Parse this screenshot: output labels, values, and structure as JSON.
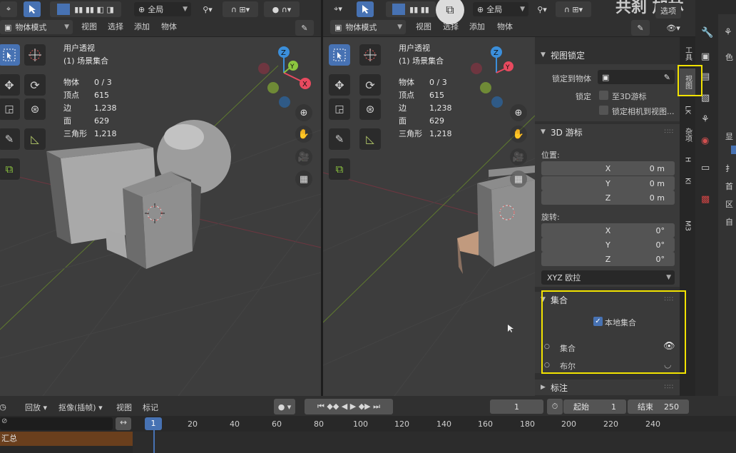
{
  "colors": {
    "accent": "#4772b3",
    "highlight": "#f2e300",
    "x_axis": "#e84a5f",
    "y_axis": "#8cc63f",
    "z_axis": "#3b8fdb"
  },
  "left_viewport": {
    "header": {
      "pivot_label": "全局",
      "mode": "物体模式",
      "menus": [
        "视图",
        "选择",
        "添加",
        "物体"
      ]
    },
    "overlay_title": "用户透视",
    "overlay_subtitle": "(1) 场景集合",
    "stats": [
      {
        "label": "物体",
        "value": "0 / 3"
      },
      {
        "label": "顶点",
        "value": "615"
      },
      {
        "label": "边",
        "value": "1,238"
      },
      {
        "label": "面",
        "value": "629"
      },
      {
        "label": "三角形",
        "value": "1,218"
      }
    ],
    "gizmo": {
      "x": "X",
      "y": "Y",
      "z": "Z"
    }
  },
  "right_viewport": {
    "header": {
      "pivot_label": "全局",
      "mode": "物体模式",
      "menus": [
        "视图",
        "选择",
        "添加",
        "物体"
      ],
      "options": "选项",
      "top_text": "共刹  加林"
    },
    "overlay_title": "用户透视",
    "overlay_subtitle": "(1) 场景集合",
    "stats": [
      {
        "label": "物体",
        "value": "0 / 3"
      },
      {
        "label": "顶点",
        "value": "615"
      },
      {
        "label": "边",
        "value": "1,238"
      },
      {
        "label": "面",
        "value": "629"
      },
      {
        "label": "三角形",
        "value": "1,218"
      }
    ],
    "gizmo": {
      "x": "X",
      "y": "Y",
      "z": "Z"
    }
  },
  "sidebar": {
    "view_lock_title": "视图锁定",
    "lock_to_object_label": "锁定到物体",
    "lock_label": "锁定",
    "lock_to_cursor": "至3D游标",
    "lock_camera": "锁定相机到视图...",
    "cursor_title": "3D 游标",
    "location_label": "位置:",
    "location": [
      {
        "axis": "X",
        "value": "0 m"
      },
      {
        "axis": "Y",
        "value": "0 m"
      },
      {
        "axis": "Z",
        "value": "0 m"
      }
    ],
    "rotation_label": "旋转:",
    "rotation": [
      {
        "axis": "X",
        "value": "0°"
      },
      {
        "axis": "Y",
        "value": "0°"
      },
      {
        "axis": "Z",
        "value": "0°"
      }
    ],
    "rotation_mode": "XYZ 欧拉",
    "collections_title": "集合",
    "local_collection": "本地集合",
    "collection_items": [
      "集合",
      "布尔"
    ],
    "annotations_title": "标注"
  },
  "vertical_tabs": [
    "工具",
    "视图",
    "LK",
    "杂项",
    "H",
    "KI",
    "M3"
  ],
  "timeline": {
    "menus": [
      "回放",
      "抠像(插帧)",
      "视图",
      "标记"
    ],
    "current_frame": "1",
    "start_label": "起始",
    "start_value": "1",
    "end_label": "结束",
    "end_value": "250",
    "ruler": [
      "1",
      "20",
      "40",
      "60",
      "80",
      "100",
      "120",
      "140",
      "160",
      "180",
      "200",
      "220",
      "240"
    ],
    "summary_label": "汇总"
  },
  "props_partial": [
    "色",
    "显",
    "扌",
    "首",
    "区",
    "自"
  ]
}
